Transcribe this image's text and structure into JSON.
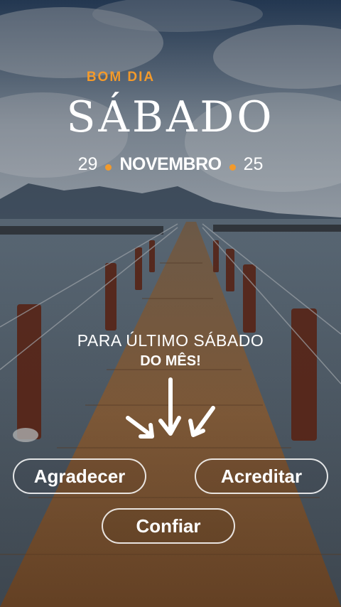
{
  "header": {
    "greeting": "BOM DIA",
    "day": "SÁBADO",
    "date": {
      "day": "29",
      "month": "NOVEMBRO",
      "year": "25"
    }
  },
  "message": {
    "line1": "PARA ÚLTIMO SÁBADO",
    "line2": "DO MÊS!"
  },
  "buttons": {
    "agradecer": "Agradecer",
    "acreditar": "Acreditar",
    "confiar": "Confiar"
  },
  "colors": {
    "accent": "#f39a2b",
    "text": "#ffffff"
  }
}
